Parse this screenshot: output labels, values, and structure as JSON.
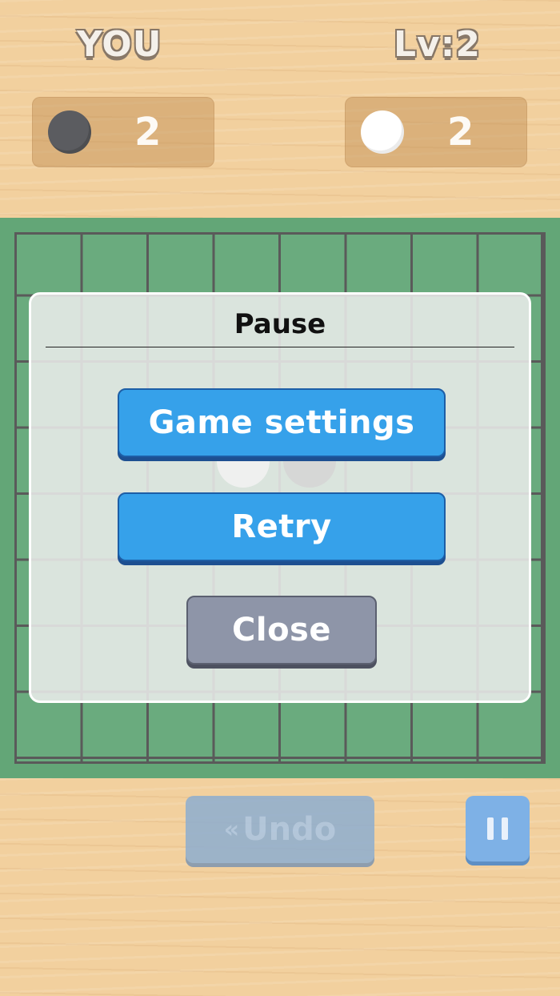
{
  "header": {
    "player_label": "YOU",
    "opponent_label": "Lv:2"
  },
  "scores": {
    "player": {
      "disc_color": "black",
      "count": "2"
    },
    "opponent": {
      "disc_color": "white",
      "count": "2"
    }
  },
  "board": {
    "size": 8,
    "colors": {
      "felt": "#63a677",
      "lines": "#5a5a5a"
    }
  },
  "controls": {
    "undo_icon": "«",
    "undo_label": "Undo",
    "pause_icon": "pause-icon"
  },
  "pause_dialog": {
    "title": "Pause",
    "game_settings_label": "Game settings",
    "retry_label": "Retry",
    "close_label": "Close"
  },
  "colors": {
    "primary_button": "#36a1ea",
    "secondary_button": "#8e95a8"
  }
}
